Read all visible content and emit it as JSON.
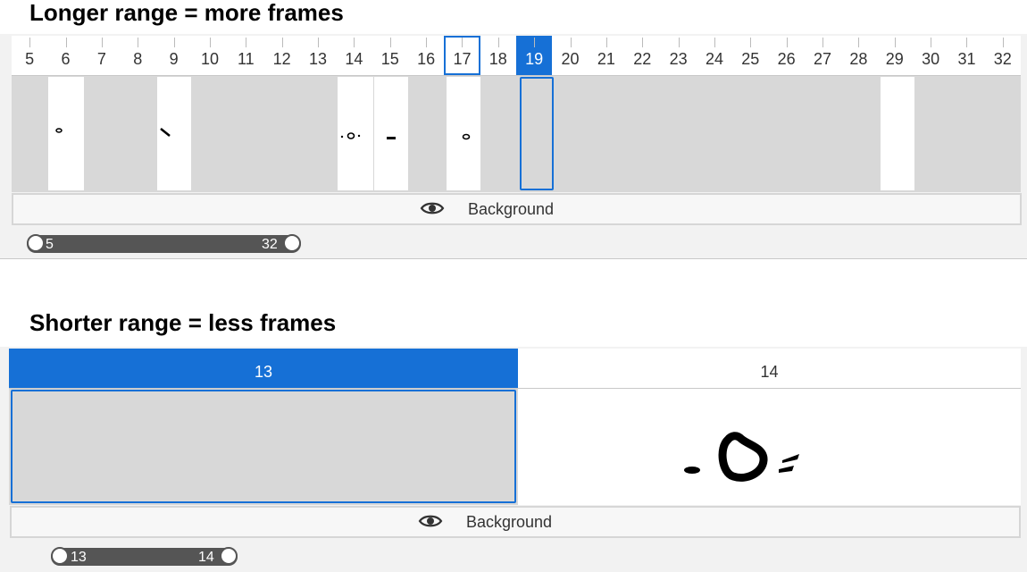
{
  "top": {
    "heading": "Longer range = more frames",
    "frames": [
      "5",
      "6",
      "7",
      "8",
      "9",
      "10",
      "11",
      "12",
      "13",
      "14",
      "15",
      "16",
      "17",
      "18",
      "19",
      "20",
      "21",
      "22",
      "23",
      "24",
      "25",
      "26",
      "27",
      "28",
      "29",
      "30",
      "31",
      "32"
    ],
    "current_frame": "19",
    "layer_label": "Background",
    "range_start": "5",
    "range_end": "32"
  },
  "bottom": {
    "heading": "Shorter range = less frames",
    "frames": [
      "13",
      "14"
    ],
    "current_frame": "13",
    "layer_label": "Background",
    "range_start": "13",
    "range_end": "14"
  },
  "colors": {
    "accent": "#1670d6",
    "track": "#d8d8d8",
    "range_bar": "#555555"
  },
  "icons": {
    "visibility": "eye-icon"
  }
}
